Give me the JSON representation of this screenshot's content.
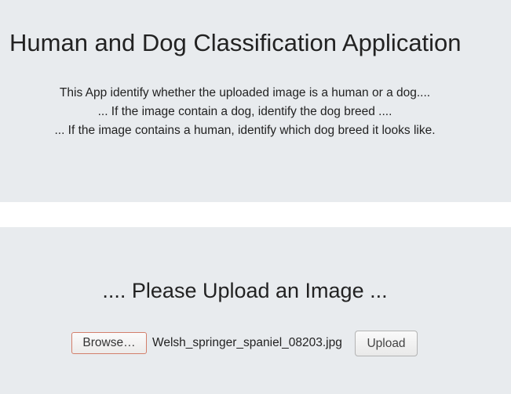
{
  "hero": {
    "title": "Human and Dog Classification Application",
    "description_lines": [
      "This App identify whether the uploaded image is a human or a dog....",
      "... If the image contain a dog, identify the dog breed ....",
      "... If the image contains a human, identify which dog breed it looks like."
    ]
  },
  "upload": {
    "heading": ".... Please Upload an Image ...",
    "browse_label": "Browse…",
    "selected_file": "Welsh_springer_spaniel_08203.jpg",
    "submit_label": "Upload"
  },
  "colors": {
    "section_background": "#e8ebee",
    "page_background": "#ffffff",
    "text": "#222222",
    "browse_border_focus": "#d37f6b"
  }
}
